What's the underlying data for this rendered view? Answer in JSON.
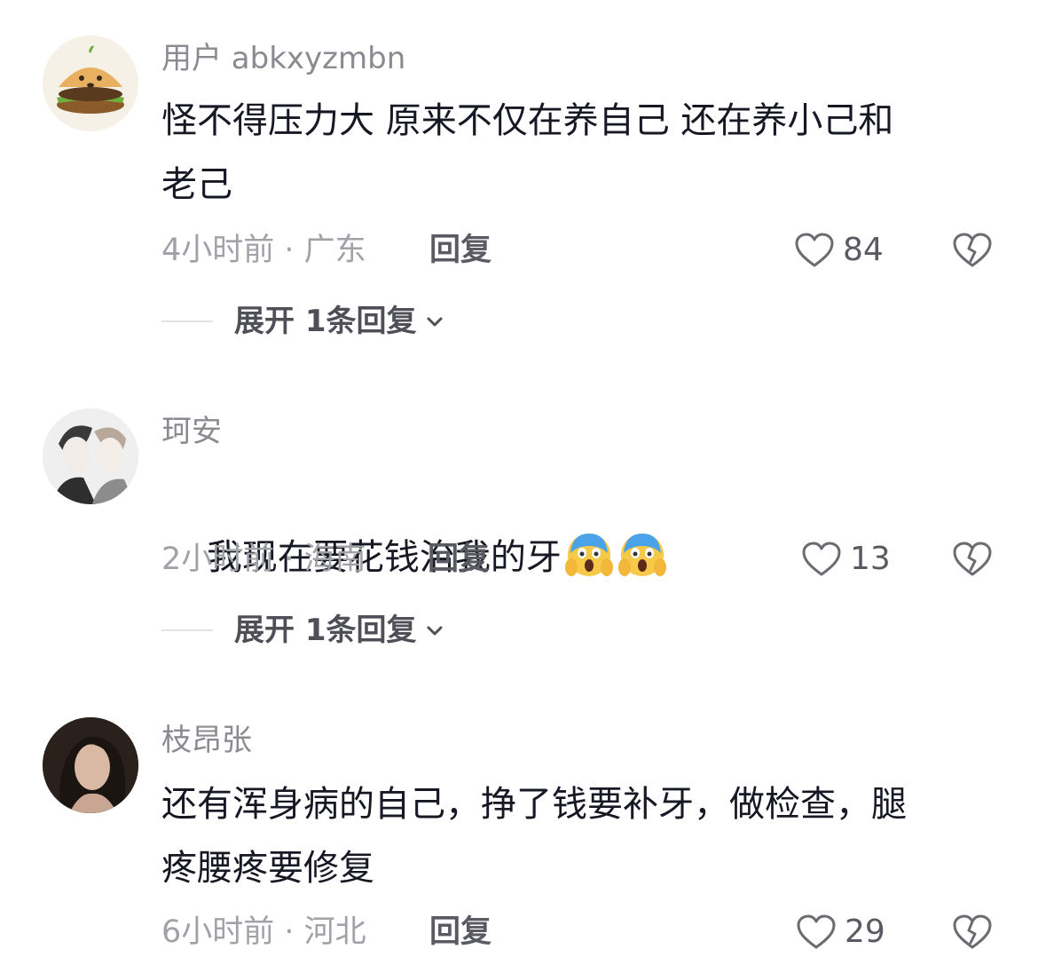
{
  "comments": [
    {
      "avatar": "burger-avatar",
      "username": "用户 abkxyzmbn",
      "text": "怪不得压力大 原来不仅在养自己 还在养小己和\n老己",
      "time_location": "4小时前 · 广东",
      "reply_label": "回复",
      "likes": "84",
      "expand_label": "展开 1条回复"
    },
    {
      "avatar": "anime-avatar",
      "username": "珂安",
      "text": "我现在要花钱治我的牙",
      "emojis": [
        "scream-emoji",
        "scream-emoji"
      ],
      "time_location": "2小时前 · 海南",
      "reply_label": "回复",
      "likes": "13",
      "expand_label": "展开 1条回复"
    },
    {
      "avatar": "photo-avatar",
      "username": "枝昂张",
      "text": "还有浑身病的自己，挣了钱要补牙，做检查，腿\n疼腰疼要修复",
      "time_location": "6小时前 · 河北",
      "reply_label": "回复",
      "likes": "29"
    }
  ],
  "colors": {
    "text": "#161823",
    "muted": "#a1a2a8",
    "username": "#8a8b91"
  }
}
